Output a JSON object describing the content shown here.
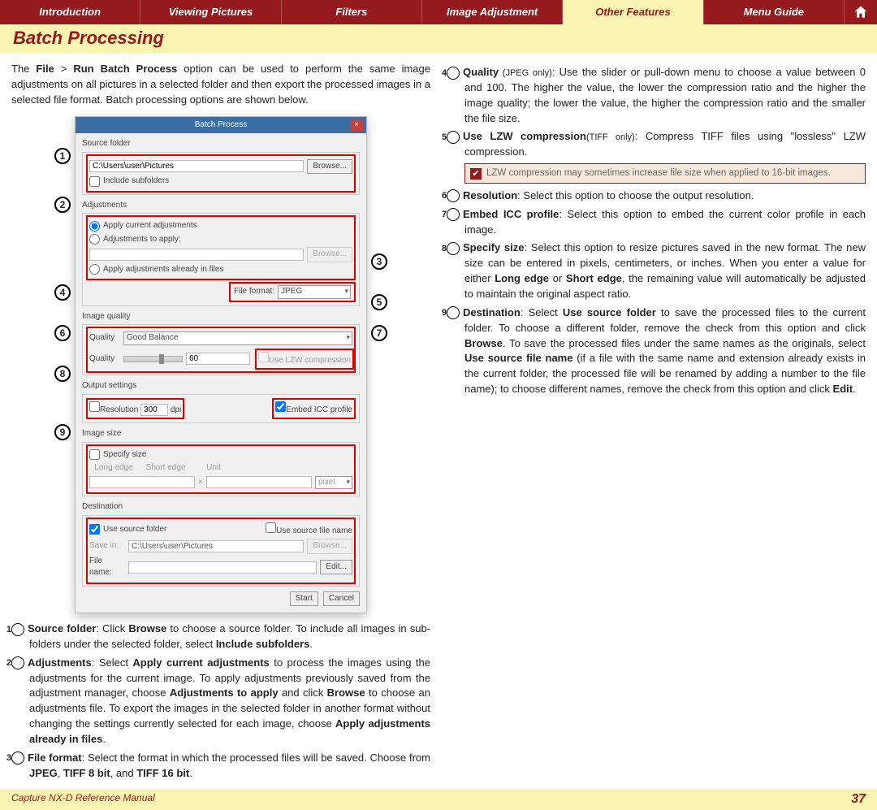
{
  "nav": {
    "items": [
      "Introduction",
      "Viewing Pictures",
      "Filters",
      "Image Adjustment",
      "Other Features",
      "Menu Guide"
    ],
    "active_index": 4
  },
  "title": "Batch Processing",
  "intro": {
    "pre": "The ",
    "b1": "File",
    "mid1": " > ",
    "b2": "Run Batch Process",
    "post": " option can be used to perform the same image adjustments on all pictures in a selected folder and then export the processed images in a selected file format. Batch processing options are shown below."
  },
  "dialog": {
    "title": "Batch Process",
    "source_label": "Source folder",
    "source_path": "C:\\Users\\user\\Pictures",
    "browse": "Browse...",
    "include_sub": "Include subfolders",
    "adjustments_label": "Adjustments",
    "apply_current": "Apply current adjustments",
    "adj_to_apply": "Adjustments to apply:",
    "apply_already": "Apply adjustments already in files",
    "file_format_label": "File format:",
    "file_format_value": "JPEG",
    "image_quality_label": "Image quality",
    "quality": "Quality",
    "quality_value": "Good Balance",
    "quality_num": "60",
    "lzw": "Use LZW compression",
    "output_label": "Output settings",
    "resolution": "Resolution",
    "resolution_val": "300",
    "dpi": "dpi",
    "embed_icc": "Embed ICC profile",
    "image_size_label": "Image size",
    "specify_size": "Specify size",
    "long_edge": "Long edge",
    "short_edge": "Short edge",
    "unit": "Unit",
    "unit_val": "pixel",
    "destination_label": "Destination",
    "use_src_folder": "Use source folder",
    "use_src_name": "Use source file name",
    "save_in": "Save in:",
    "save_path": "C:\\Users\\user\\Pictures",
    "file_name": "File name:",
    "edit": "Edit...",
    "start": "Start",
    "cancel": "Cancel"
  },
  "callouts": [
    "1",
    "2",
    "3",
    "4",
    "5",
    "6",
    "7",
    "8",
    "9"
  ],
  "items_left": [
    {
      "n": "1",
      "lead": "Source folder",
      "text": ": Click ",
      "b": [
        "Browse"
      ],
      "rest": " to choose a source folder. To include all images in sub-folders under the selected folder, select ",
      "b2": "Include subfolders",
      "tail": "."
    },
    {
      "n": "2",
      "lead": "Adjustments",
      "text": ": Select ",
      "b": [
        "Apply current adjustments"
      ],
      "rest": " to process the images using the adjustments for the current image. To apply adjustments previously saved from the adjustment manager, choose ",
      "b2": "Adjustments to apply",
      "tail": " and click ",
      "b3": "Browse",
      "tail2": " to choose an adjustments file. To export the images in the selected folder in another format without changing the settings currently selected for each image, choose ",
      "b4": "Apply adjustments already in files",
      "tail3": "."
    },
    {
      "n": "3",
      "lead": "File format",
      "text": ": Select the format in which the processed files will be saved. Choose from ",
      "b": [
        "JPEG"
      ],
      "mid": ", ",
      "b2": "TIFF 8 bit",
      "mid2": ", and ",
      "b3": "TIFF 16 bit",
      "tail": "."
    }
  ],
  "items_right": [
    {
      "n": "4",
      "lead": "Quality",
      "note": " (JPEG only)",
      "text": ": Use the slider or pull-down menu to choose a value between 0 and 100. The higher the value, the lower the compression ratio and the higher the image quality; the lower the value, the higher the compression ratio and the smaller the file size."
    },
    {
      "n": "5",
      "lead": "Use LZW compression",
      "note": "(TIFF only)",
      "text": ": Compress TIFF files using \"lossless\" LZW compression."
    },
    {
      "n": "6",
      "lead": "Resolution",
      "text": ": Select this option to choose the output resolution."
    },
    {
      "n": "7",
      "lead": "Embed ICC profile",
      "text": ": Select this option to embed the current color profile in each image."
    },
    {
      "n": "8",
      "lead": "Specify size",
      "text": ": Select this option to resize pictures saved in the new format. The new size can be entered in pixels, centimeters, or inches. When you enter a value for either ",
      "b": "Long edge",
      "mid": " or ",
      "b2": "Short edge",
      "tail": ", the remaining value will automatically be adjusted to maintain the original aspect ratio."
    },
    {
      "n": "9",
      "lead": "Destination",
      "text": ": Select ",
      "b": "Use source folder",
      "mid": " to save the processed files to the current folder. To choose a different folder, remove the check from this option and click ",
      "b2": "Browse",
      "mid2": ". To save the processed files under the same names as the originals, select ",
      "b3": "Use source file name",
      "tail": " (if a file with the same name and extension already exists in the current folder, the processed file will be renamed by adding a number to the file name); to choose different names, remove the check from this option and click ",
      "b4": "Edit",
      "tail2": "."
    }
  ],
  "tip": "LZW compression may sometimes increase file size when applied to 16-bit images.",
  "footer": {
    "title": "Capture NX-D Reference Manual",
    "page": "37"
  }
}
